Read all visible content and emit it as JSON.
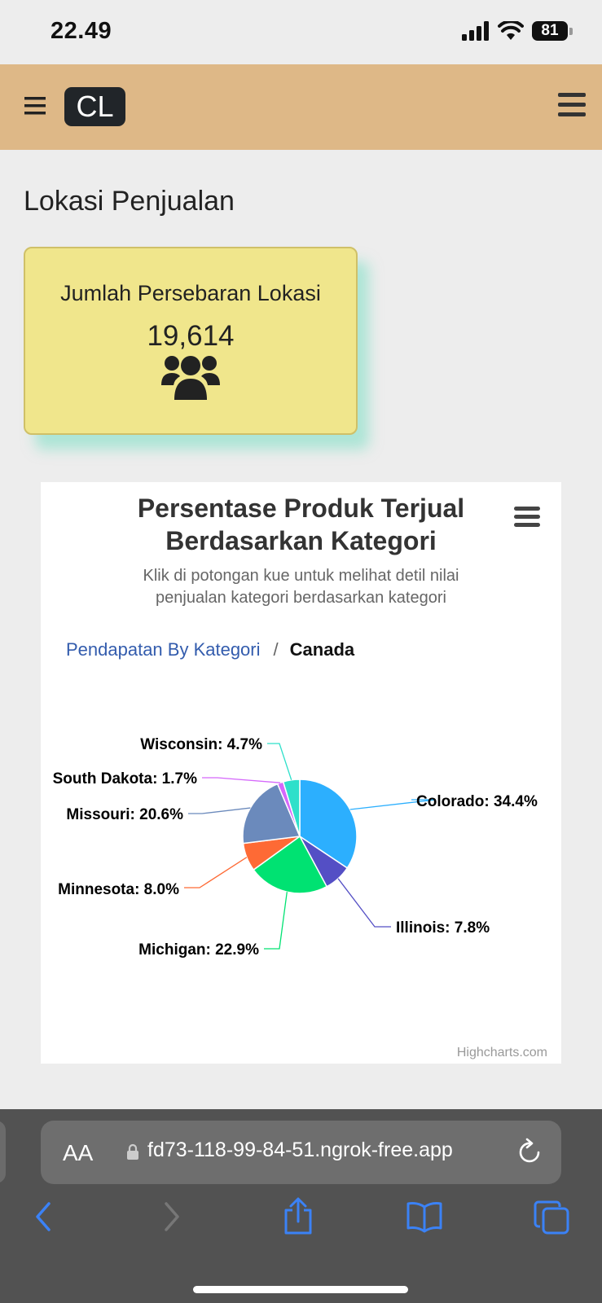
{
  "status": {
    "time": "22.49",
    "battery": "81"
  },
  "navbar": {
    "brand": "CL"
  },
  "page_title": "Lokasi Penjualan",
  "stat_card": {
    "label": "Jumlah Persebaran Lokasi",
    "value": "19,614",
    "icon": "users-icon"
  },
  "chart": {
    "title_line1": "Persentase Produk Terjual",
    "title_line2": "Berdasarkan Kategori",
    "subtitle_line1": "Klik di potongan kue untuk melihat detil nilai",
    "subtitle_line2": "penjualan kategori berdasarkan kategori",
    "breadcrumb_link": "Pendapatan By Kategori",
    "breadcrumb_sep": "/",
    "breadcrumb_current": "Canada",
    "credits": "Highcharts.com"
  },
  "chart_data": {
    "type": "pie",
    "categories": [
      "Colorado",
      "Illinois",
      "Michigan",
      "Minnesota",
      "Missouri",
      "South Dakota",
      "Wisconsin"
    ],
    "values": [
      34.4,
      7.8,
      22.9,
      8.0,
      20.6,
      1.7,
      4.7
    ],
    "labels": [
      "Colorado: 34.4%",
      "Illinois: 7.8%",
      "Michigan: 22.9%",
      "Minnesota: 8.0%",
      "Missouri: 20.6%",
      "South Dakota: 1.7%",
      "Wisconsin: 4.7%"
    ],
    "colors": [
      "#2caffe",
      "#544fc5",
      "#00e272",
      "#fe6a35",
      "#6b8abc",
      "#d568fb",
      "#2ee0ca"
    ]
  },
  "browser": {
    "aa_label": "AA",
    "url": "fd73-118-99-84-51.ngrok-free.app"
  },
  "theme": {
    "navbar": "#deb887",
    "card": "#f0e68c",
    "accent_link": "#335cad",
    "browser_ui": "#525252",
    "toolbar_icon": "#3b82f6"
  }
}
